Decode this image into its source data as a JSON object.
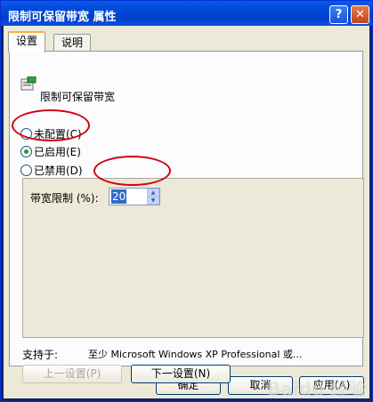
{
  "window": {
    "title": "限制可保留带宽 属性",
    "help_glyph": "?",
    "close_glyph": "✕"
  },
  "tabs": [
    "设置",
    "说明"
  ],
  "policy": {
    "icon": "policy-setting-icon",
    "name": "限制可保留带宽"
  },
  "options": {
    "not_configured": "未配置(C)",
    "enabled": "已启用(E)",
    "disabled": "已禁用(D)",
    "selected": "enabled"
  },
  "bandwidth": {
    "label": "带宽限制 (%):",
    "value": "20"
  },
  "supported": {
    "label": "支持于:",
    "text": "至少 Microsoft Windows XP Professional 或..."
  },
  "nav_buttons": {
    "prev": "上一设置(P)",
    "next": "下一设置(N)"
  },
  "dialog_buttons": {
    "ok": "确定",
    "cancel": "取消",
    "apply": "应用(A)"
  },
  "watermark": "Baidu 经验",
  "annotation_color": "#d10010"
}
